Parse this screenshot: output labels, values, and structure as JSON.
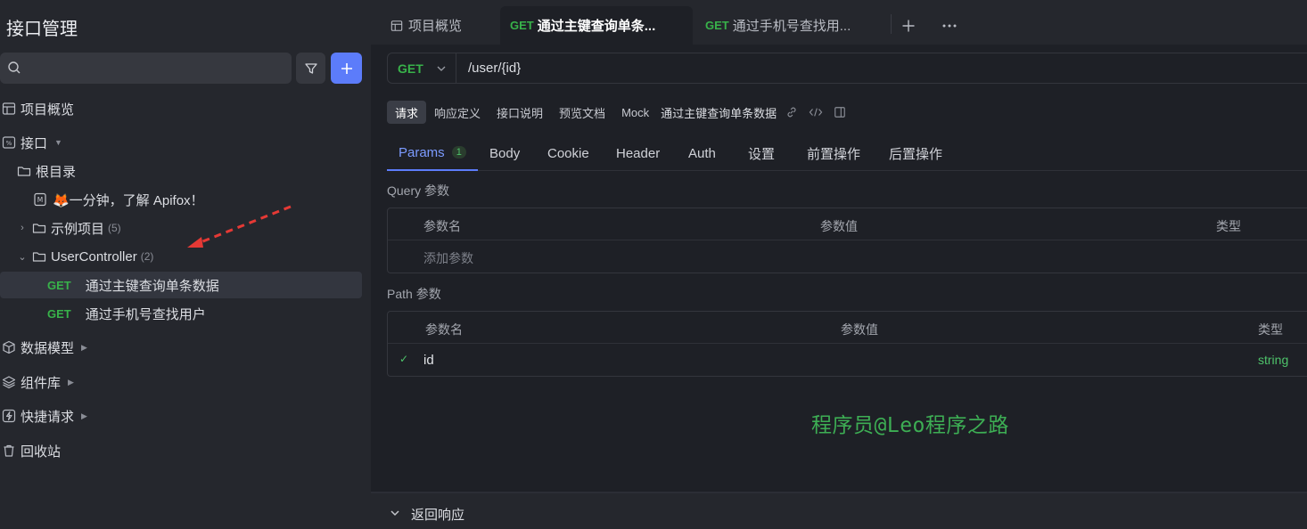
{
  "sidebar": {
    "title": "接口管理",
    "overview": "项目概览",
    "apis_section": "接口",
    "root": "根目录",
    "doc_item": "🦊一分钟，了解 Apifox！",
    "folders": [
      {
        "label": "示例项目",
        "count": "(5)"
      },
      {
        "label": "UserController",
        "count": "(2)"
      }
    ],
    "endpoints": [
      {
        "method": "GET",
        "label": "通过主键查询单条数据"
      },
      {
        "method": "GET",
        "label": "通过手机号查找用户"
      }
    ],
    "sections": [
      "数据模型",
      "组件库",
      "快捷请求",
      "回收站"
    ]
  },
  "tabs": [
    {
      "label": "项目概览"
    },
    {
      "method": "GET",
      "label": "通过主键查询单条..."
    },
    {
      "method": "GET",
      "label": "通过手机号查找用..."
    }
  ],
  "request": {
    "method": "GET",
    "url": "/user/{id}"
  },
  "subtabs": [
    "请求",
    "响应定义",
    "接口说明",
    "预览文档",
    "Mock"
  ],
  "endpoint_name": "通过主键查询单条数据",
  "param_tabs": {
    "params": "Params",
    "params_count": "1",
    "others": [
      "Body",
      "Cookie",
      "Header",
      "Auth",
      "设置",
      "前置操作",
      "后置操作"
    ]
  },
  "query": {
    "title": "Query 参数",
    "headers": [
      "参数名",
      "参数值",
      "类型"
    ],
    "add_placeholder": "添加参数"
  },
  "path": {
    "title": "Path 参数",
    "headers": [
      "参数名",
      "参数值",
      "类型"
    ],
    "rows": [
      {
        "check": "✓",
        "name": "id",
        "type": "string"
      }
    ]
  },
  "watermark": "程序员@Leo程序之路",
  "response_section": "返回响应",
  "colors": {
    "accent": "#5c7cfa",
    "get": "#38b24a",
    "annotation_arrow": "#e53935"
  }
}
